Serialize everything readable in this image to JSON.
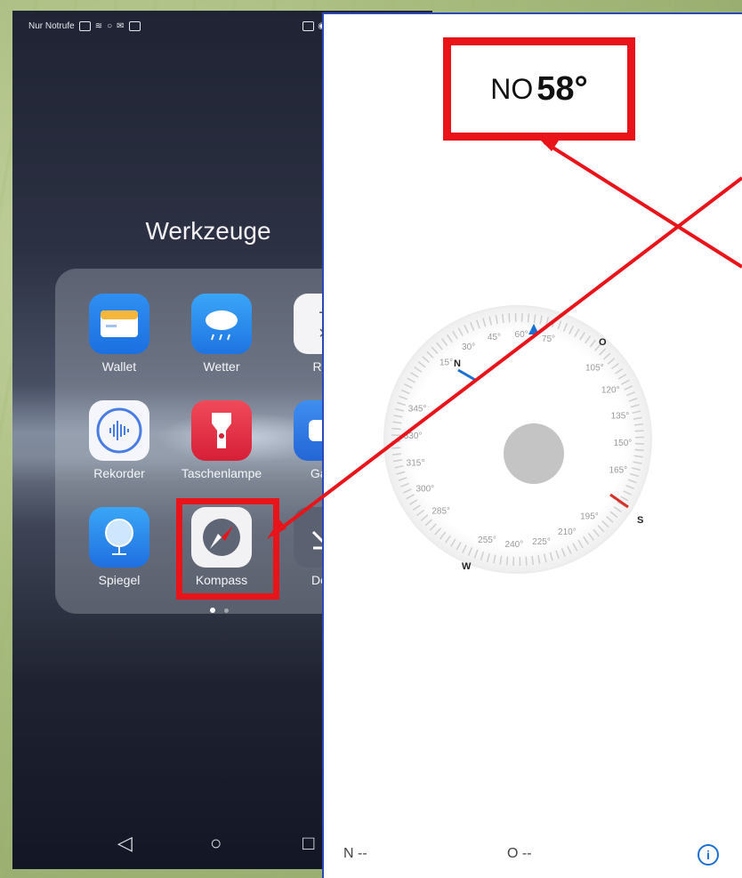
{
  "status_bar": {
    "carrier": "Nur Notrufe"
  },
  "folder": {
    "title": "Werkzeuge",
    "apps": [
      {
        "name": "Wallet",
        "icon": "wallet-icon"
      },
      {
        "name": "Wetter",
        "icon": "weather-icon"
      },
      {
        "name": "Rec",
        "icon": "calculator-icon"
      },
      {
        "name": "Rekorder",
        "icon": "recorder-icon"
      },
      {
        "name": "Taschenlampe",
        "icon": "flashlight-icon"
      },
      {
        "name": "Gam",
        "icon": "game-icon"
      },
      {
        "name": "Spiegel",
        "icon": "mirror-icon"
      },
      {
        "name": "Kompass",
        "icon": "compass-icon"
      },
      {
        "name": "Dow",
        "icon": "download-icon"
      }
    ]
  },
  "compass": {
    "heading_direction": "NO",
    "heading_degrees": "58°",
    "cardinals": {
      "n": "N",
      "o": "O",
      "s": "S",
      "w": "W"
    },
    "degree_labels": [
      "15°",
      "30°",
      "45°",
      "60°",
      "75°",
      "105°",
      "120°",
      "135°",
      "150°",
      "165°",
      "195°",
      "210°",
      "225°",
      "240°",
      "255°",
      "285°",
      "300°",
      "315°",
      "330°",
      "345°"
    ],
    "coord_n": "N --",
    "coord_o": "O --",
    "info_label": "i"
  },
  "colors": {
    "highlight": "#e8141a",
    "north_needle": "#1a6fd3",
    "south_needle": "#d8302a"
  }
}
